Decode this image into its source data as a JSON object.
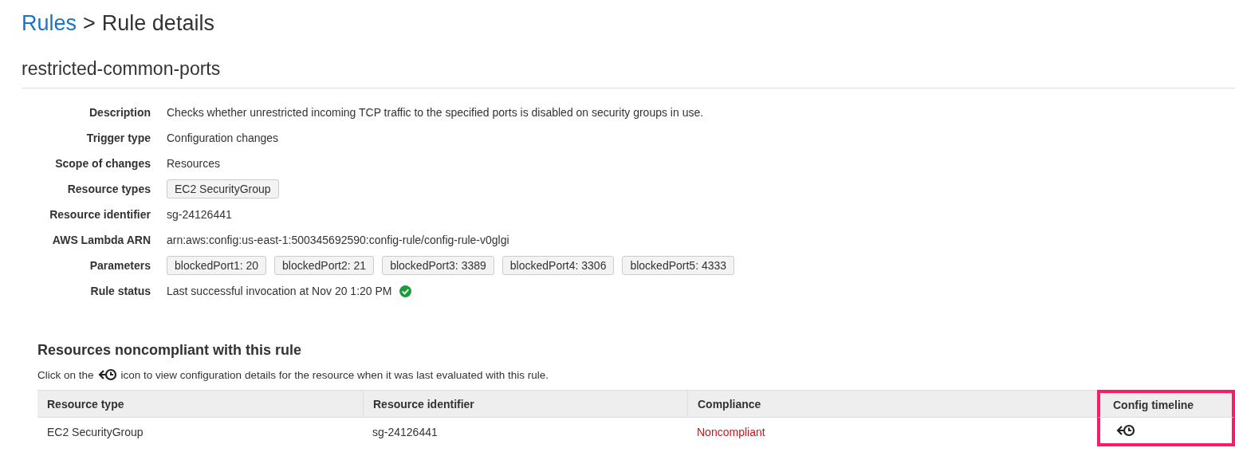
{
  "breadcrumb": {
    "link": "Rules",
    "separator": ">",
    "current": "Rule details"
  },
  "rule_name": "restricted-common-ports",
  "details": [
    {
      "label": "Description",
      "kind": "text",
      "value": "Checks whether unrestricted incoming TCP traffic to the specified ports is disabled on security groups in use."
    },
    {
      "label": "Trigger type",
      "kind": "text",
      "value": "Configuration changes"
    },
    {
      "label": "Scope of changes",
      "kind": "text",
      "value": "Resources"
    },
    {
      "label": "Resource types",
      "kind": "tags",
      "tags": [
        "EC2 SecurityGroup"
      ]
    },
    {
      "label": "Resource identifier",
      "kind": "text",
      "value": "sg-24126441"
    },
    {
      "label": "AWS Lambda ARN",
      "kind": "text",
      "value": "arn:aws:config:us-east-1:500345692590:config-rule/config-rule-v0glgi"
    },
    {
      "label": "Parameters",
      "kind": "tags",
      "tags": [
        "blockedPort1: 20",
        "blockedPort2: 21",
        "blockedPort3: 3389",
        "blockedPort4: 3306",
        "blockedPort5: 4333"
      ]
    },
    {
      "label": "Rule status",
      "kind": "status",
      "value": "Last successful invocation at Nov 20 1:20 PM",
      "ok": true
    }
  ],
  "section": {
    "title": "Resources noncompliant with this rule",
    "hint_before": "Click on the",
    "hint_after": "icon to view configuration details for the resource when it was last evaluated with this rule."
  },
  "table": {
    "columns": [
      {
        "label": "Resource type",
        "highlighted": false
      },
      {
        "label": "Resource identifier",
        "highlighted": false
      },
      {
        "label": "Compliance",
        "highlighted": false
      },
      {
        "label": "Config timeline",
        "highlighted": true
      }
    ],
    "rows": [
      {
        "resource_type": "EC2 SecurityGroup",
        "resource_identifier": "sg-24126441",
        "compliance": {
          "text": "Noncompliant",
          "color": "#c7161e"
        }
      }
    ]
  }
}
